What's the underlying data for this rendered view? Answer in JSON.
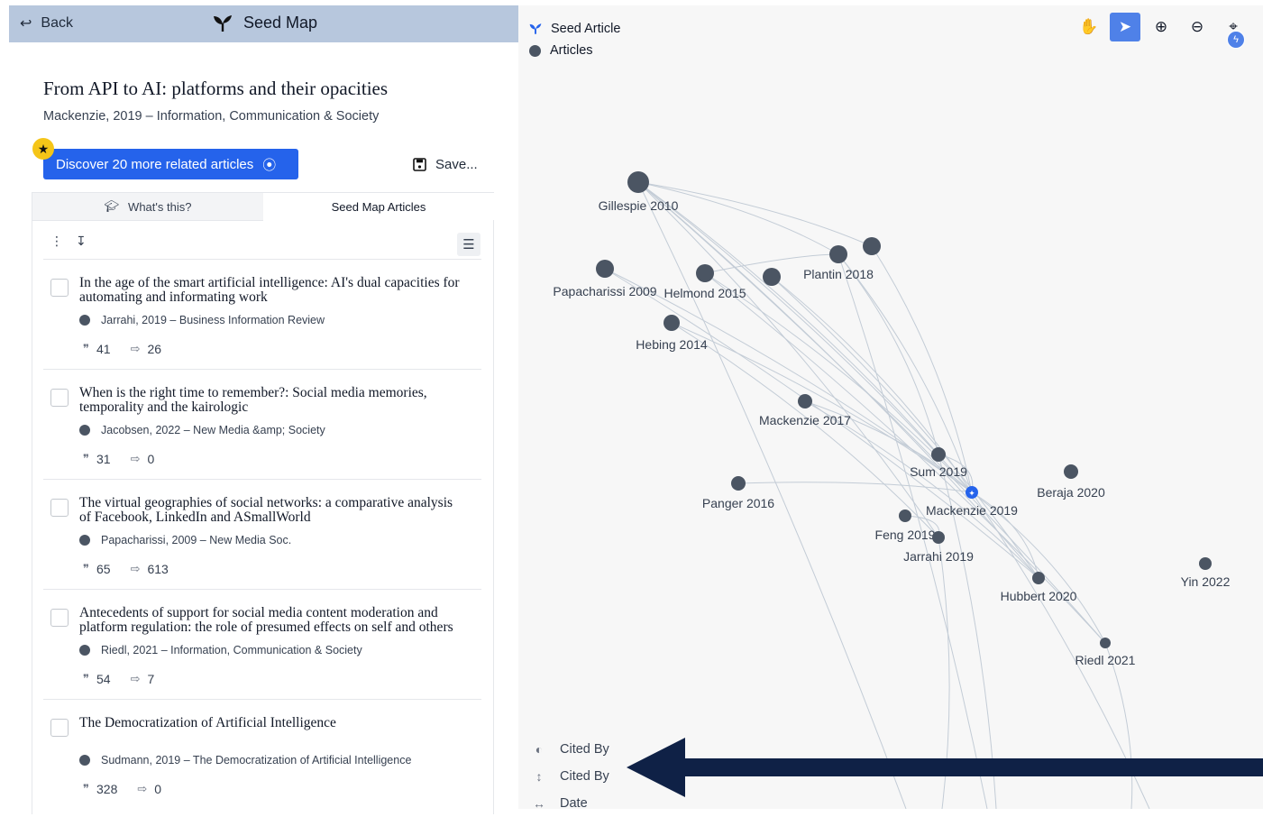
{
  "header": {
    "back_label": "Back",
    "title": "Seed Map"
  },
  "paper": {
    "title": "From API to AI: platforms and their opacities",
    "subtitle": "Mackenzie, 2019 – Information, Communication & Society"
  },
  "actions": {
    "discover_label": "Discover 20 more related articles",
    "save_label": "Save..."
  },
  "tabs": [
    {
      "label": "What's this?"
    },
    {
      "label": "Seed Map Articles"
    }
  ],
  "articles": [
    {
      "title": "In the age of the smart artificial intelligence: AI's dual capacities for automating and informating work",
      "meta": "Jarrahi, 2019 – Business Information Review",
      "citations": "41",
      "references": "26"
    },
    {
      "title": "When is the right time to remember?: Social media memories, temporality and the kairologic",
      "meta": "Jacobsen, 2022 – New Media &amp; Society",
      "citations": "31",
      "references": "0"
    },
    {
      "title": "The virtual geographies of social networks: a comparative analysis of Facebook, LinkedIn and ASmallWorld",
      "meta": "Papacharissi, 2009 – New Media Soc.",
      "citations": "65",
      "references": "613"
    },
    {
      "title": "Antecedents of support for social media content moderation and platform regulation: the role of presumed effects on self and others",
      "meta": "Riedl, 2021 – Information, Communication & Society",
      "citations": "54",
      "references": "7"
    },
    {
      "title": "The Democratization of Artificial Intelligence",
      "meta": "Sudmann, 2019 – The Democratization of Artificial Intelligence",
      "citations": "328",
      "references": "0"
    }
  ],
  "legend": {
    "seed_label": "Seed Article",
    "articles_label": "Articles"
  },
  "bottom_legend": [
    {
      "icon": "color-scale-icon",
      "label": "Cited By"
    },
    {
      "icon": "vertical-arrow-icon",
      "label": "Cited By"
    },
    {
      "icon": "horizontal-arrow-icon",
      "label": "Date"
    }
  ],
  "graph": {
    "nodes": [
      {
        "id": "gillespie",
        "label": "Gillespie 2010"
      },
      {
        "id": "papacharissi",
        "label": "Papacharissi 2009"
      },
      {
        "id": "helmond",
        "label": "Helmond 2015"
      },
      {
        "id": "plantin",
        "label": "Plantin 2018"
      },
      {
        "id": "hebing",
        "label": "Hebing 2014"
      },
      {
        "id": "mackenzie2017",
        "label": "Mackenzie 2017"
      },
      {
        "id": "sum",
        "label": "Sum 2019"
      },
      {
        "id": "panger",
        "label": "Panger 2016"
      },
      {
        "id": "mackenzie2019",
        "label": "Mackenzie 2019",
        "seed": true
      },
      {
        "id": "beraja",
        "label": "Beraja 2020"
      },
      {
        "id": "feng",
        "label": "Feng 2019"
      },
      {
        "id": "jarrahi",
        "label": "Jarrahi 2019"
      },
      {
        "id": "hubbert",
        "label": "Hubbert 2020"
      },
      {
        "id": "yin",
        "label": "Yin 2022"
      },
      {
        "id": "riedl",
        "label": "Riedl 2021"
      },
      {
        "id": "unlabeled1",
        "label": ""
      },
      {
        "id": "unlabeled2",
        "label": ""
      }
    ]
  },
  "colors": {
    "accent": "#2563eb",
    "node": "#4b5563",
    "arrow": "#0f2146"
  }
}
